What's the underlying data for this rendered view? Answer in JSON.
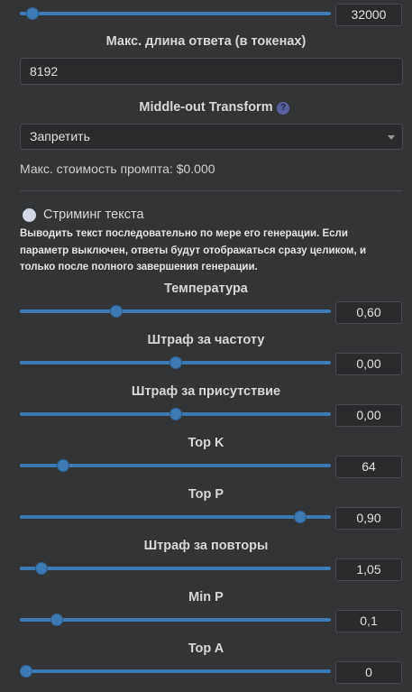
{
  "top_partial": {
    "value": "32000",
    "slider_fraction": 0.04
  },
  "max_response": {
    "label": "Макс. длина ответа (в токенах)",
    "value": "8192"
  },
  "middle_out": {
    "label": "Middle-out Transform",
    "help": "?",
    "selected": "Запретить"
  },
  "max_cost": {
    "text": "Макс. стоимость промпта: $0.000"
  },
  "streaming": {
    "label": "Стриминг текста",
    "description": "Выводить текст последовательно по мере его генерации. Если параметр выключен, ответы будут отображаться сразу целиком, и только после полного завершения генерации."
  },
  "params": [
    {
      "label": "Температура",
      "value": "0,60",
      "fraction": 0.31
    },
    {
      "label": "Штраф за частоту",
      "value": "0,00",
      "fraction": 0.5
    },
    {
      "label": "Штраф за присутствие",
      "value": "0,00",
      "fraction": 0.5
    },
    {
      "label": "Top K",
      "value": "64",
      "fraction": 0.14
    },
    {
      "label": "Top P",
      "value": "0,90",
      "fraction": 0.9
    },
    {
      "label": "Штраф за повторы",
      "value": "1,05",
      "fraction": 0.07
    },
    {
      "label": "Min P",
      "value": "0,1",
      "fraction": 0.12
    },
    {
      "label": "Top A",
      "value": "0",
      "fraction": 0.02
    }
  ],
  "colors": {
    "accent": "#3d7ab3",
    "background": "#333436",
    "field": "#2a2b2d"
  }
}
